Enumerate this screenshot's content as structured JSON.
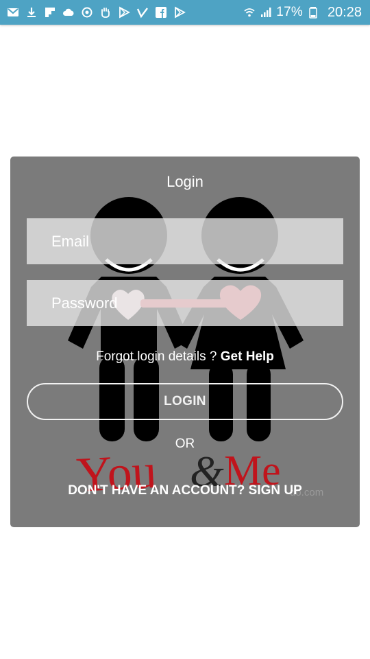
{
  "status_bar": {
    "battery_percent": "17%",
    "time": "20:28",
    "icons_left": [
      "gmail-icon",
      "download-icon",
      "flipboard-icon",
      "cloud-icon",
      "sync-icon",
      "hand-icon",
      "play-store-icon",
      "vimeo-icon",
      "facebook-icon",
      "play-store-icon"
    ],
    "icons_right": [
      "wifi-icon",
      "signal-icon",
      "battery-icon"
    ]
  },
  "login": {
    "title": "Login",
    "email_placeholder": "Email",
    "password_placeholder": "Password",
    "forgot_text": "Forgot login details ? ",
    "forgot_link": "Get Help",
    "login_button": "LOGIN",
    "or_label": "OR",
    "signup_link": "DON'T HAVE AN ACCOUNT? SIGN UP"
  },
  "background_art": {
    "logo_text": "You&Me",
    "watermark": "do.com"
  },
  "colors": {
    "status_bar": "#4ea3c4",
    "card": "#7b7b7b",
    "heart": "#e0636e",
    "logo_red": "#c0141c"
  }
}
